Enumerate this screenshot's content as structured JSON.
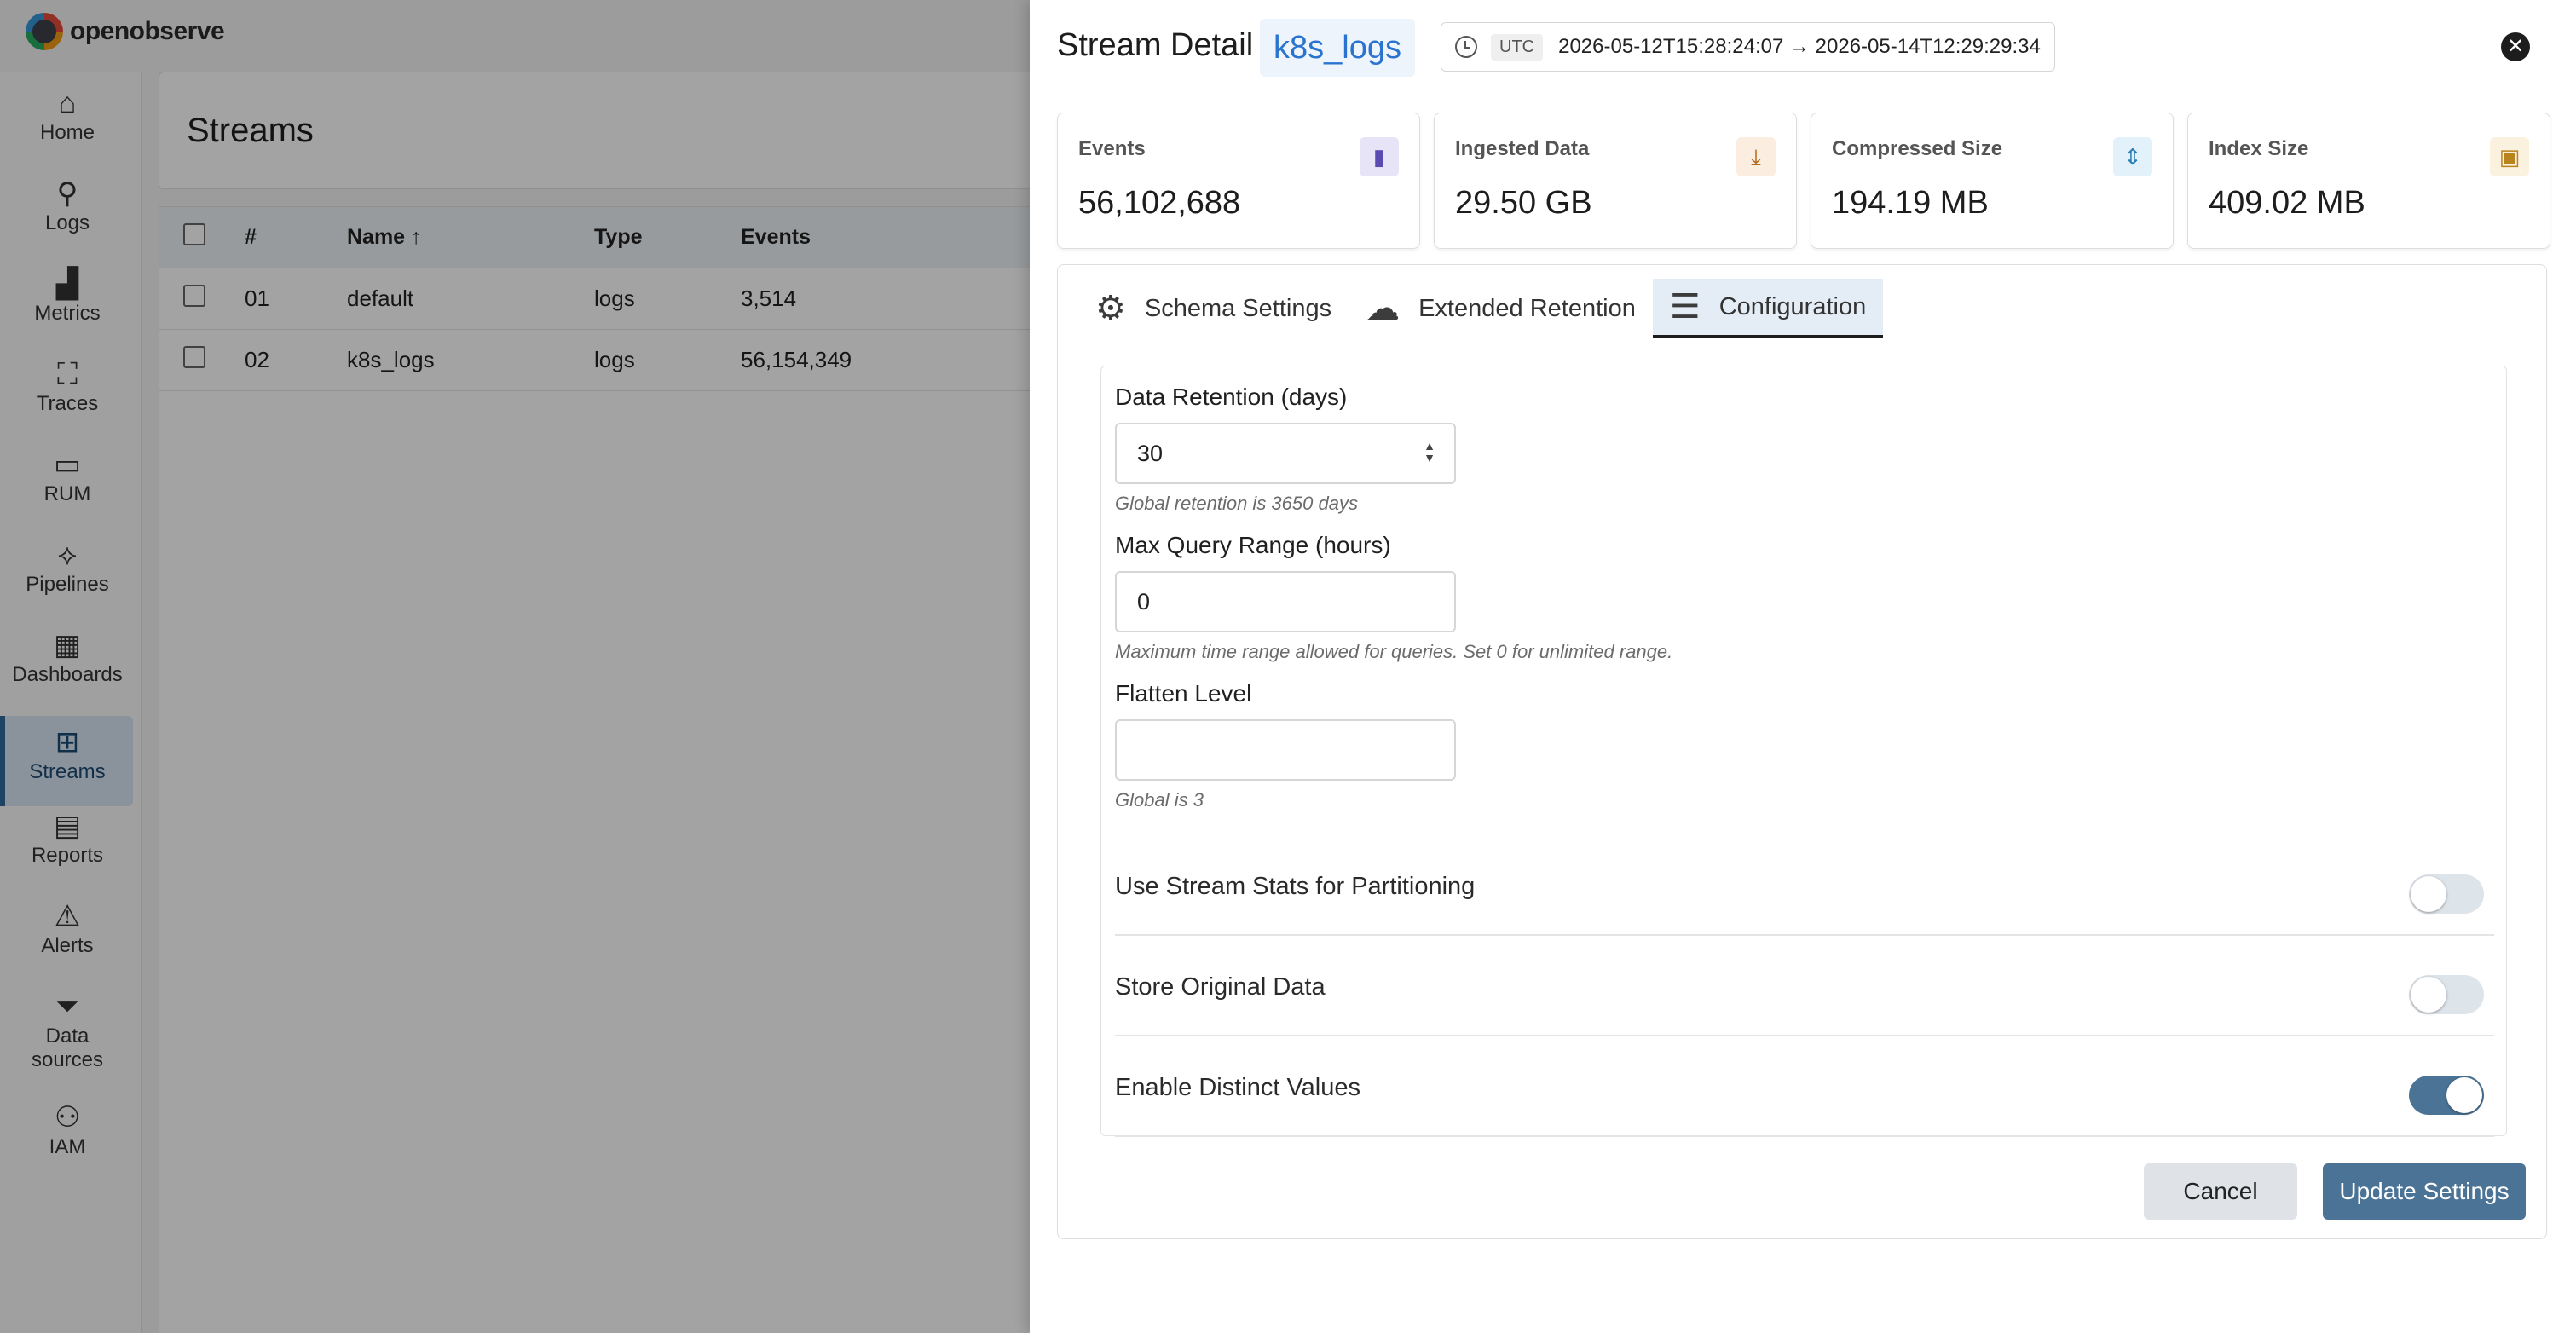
{
  "app": {
    "logo_text": "openobserve"
  },
  "sidebar": {
    "items": [
      {
        "label": "Home",
        "icon": "home-icon",
        "glyph": "⌂"
      },
      {
        "label": "Logs",
        "icon": "search-icon",
        "glyph": "⚲"
      },
      {
        "label": "Metrics",
        "icon": "bar-chart-icon",
        "glyph": "▟"
      },
      {
        "label": "Traces",
        "icon": "traces-icon",
        "glyph": "⛶"
      },
      {
        "label": "RUM",
        "icon": "devices-icon",
        "glyph": "▭"
      },
      {
        "label": "Pipelines",
        "icon": "pipelines-icon",
        "glyph": "⟡"
      },
      {
        "label": "Dashboards",
        "icon": "dashboard-icon",
        "glyph": "▦"
      },
      {
        "label": "Streams",
        "icon": "streams-icon",
        "glyph": "⊞"
      },
      {
        "label": "Reports",
        "icon": "report-icon",
        "glyph": "▤"
      },
      {
        "label": "Alerts",
        "icon": "alert-icon",
        "glyph": "⚠"
      },
      {
        "label": "Data\nsources",
        "icon": "filter-icon",
        "glyph": "⏷"
      },
      {
        "label": "IAM",
        "icon": "iam-icon",
        "glyph": "⚇"
      }
    ]
  },
  "streams_page": {
    "title": "Streams",
    "columns": {
      "num": "#",
      "name": "Name ↑",
      "type": "Type",
      "events": "Events"
    },
    "rows": [
      {
        "num": "01",
        "name": "default",
        "type": "logs",
        "events": "3,514"
      },
      {
        "num": "02",
        "name": "k8s_logs",
        "type": "logs",
        "events": "56,154,349"
      }
    ]
  },
  "drawer": {
    "title": "Stream Detail",
    "stream_name": "k8s_logs",
    "time": {
      "tz": "UTC",
      "range": "2026-05-12T15:28:24:07 → 2026-05-14T12:29:29:34"
    },
    "stats": [
      {
        "label": "Events",
        "value": "56,102,688",
        "icon": "bar-chart-icon",
        "glyph": "▮",
        "color": "#e8e4f7",
        "fg": "#5a4bb0"
      },
      {
        "label": "Ingested Data",
        "value": "29.50 GB",
        "icon": "download-tray-icon",
        "glyph": "⤓",
        "color": "#fbeee0",
        "fg": "#b26a1a"
      },
      {
        "label": "Compressed Size",
        "value": "194.19 MB",
        "icon": "compress-icon",
        "glyph": "⇕",
        "color": "#e2f1fa",
        "fg": "#2b7fb8"
      },
      {
        "label": "Index Size",
        "value": "409.02 MB",
        "icon": "save-icon",
        "glyph": "▣",
        "color": "#fbf1df",
        "fg": "#b8841d"
      }
    ],
    "tabs": [
      {
        "label": "Schema Settings",
        "icon": "gear-icon",
        "glyph": "⚙"
      },
      {
        "label": "Extended Retention",
        "icon": "cloud-upload-icon",
        "glyph": "☁"
      },
      {
        "label": "Configuration",
        "icon": "tune-icon",
        "glyph": "☰"
      }
    ],
    "config": {
      "data_retention": {
        "label": "Data Retention (days)",
        "value": "30",
        "hint": "Global retention is 3650 days"
      },
      "max_query_range": {
        "label": "Max Query Range (hours)",
        "value": "0",
        "hint": "Maximum time range allowed for queries. Set 0 for unlimited range."
      },
      "flatten_level": {
        "label": "Flatten Level",
        "value": "",
        "hint": "Global is 3"
      },
      "toggles": [
        {
          "label": "Use Stream Stats for Partitioning",
          "on": false
        },
        {
          "label": "Store Original Data",
          "on": false
        },
        {
          "label": "Enable Distinct Values",
          "on": true
        }
      ]
    },
    "buttons": {
      "cancel": "Cancel",
      "update": "Update Settings"
    }
  }
}
